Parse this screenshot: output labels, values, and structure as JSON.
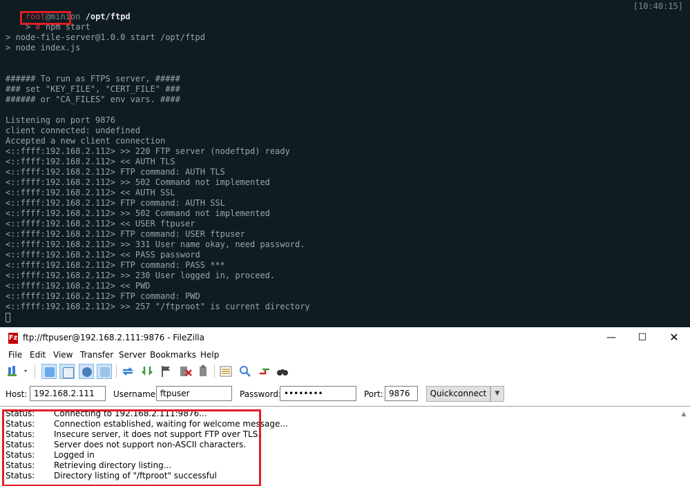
{
  "terminal": {
    "header": {
      "user": "root",
      "host": "@minion",
      "path": "/opt/ftpd",
      "time": "[10:40:15]"
    },
    "prompt": {
      "gt": ">",
      "hash": "#",
      "command": "npm start"
    },
    "lines": [
      "> node-file-server@1.0.0 start /opt/ftpd",
      "> node index.js",
      "",
      "",
      "###### To run as FTPS server, #####",
      "### set \"KEY_FILE\", \"CERT_FILE\" ###",
      "###### or \"CA_FILES\" env vars. ####",
      "",
      "Listening on port 9876",
      "client connected: undefined",
      "Accepted a new client connection",
      "<::ffff:192.168.2.112> >> 220 FTP server (nodeftpd) ready",
      "<::ffff:192.168.2.112> << AUTH TLS",
      "<::ffff:192.168.2.112> FTP command: AUTH TLS",
      "<::ffff:192.168.2.112> >> 502 Command not implemented",
      "<::ffff:192.168.2.112> << AUTH SSL",
      "<::ffff:192.168.2.112> FTP command: AUTH SSL",
      "<::ffff:192.168.2.112> >> 502 Command not implemented",
      "<::ffff:192.168.2.112> << USER ftpuser",
      "<::ffff:192.168.2.112> FTP command: USER ftpuser",
      "<::ffff:192.168.2.112> >> 331 User name okay, need password.",
      "<::ffff:192.168.2.112> << PASS password",
      "<::ffff:192.168.2.112> FTP command: PASS ***",
      "<::ffff:192.168.2.112> >> 230 User logged in, proceed.",
      "<::ffff:192.168.2.112> << PWD",
      "<::ffff:192.168.2.112> FTP command: PWD",
      "<::ffff:192.168.2.112> >> 257 \"/ftproot\" is current directory"
    ]
  },
  "filezilla": {
    "title": "ftp://ftpuser@192.168.2.111:9876 - FileZilla",
    "app_icon_letter": "Fz",
    "window_controls": {
      "minimize": "—",
      "maximize": "☐",
      "close": "✕"
    },
    "menu": [
      "File",
      "Edit",
      "View",
      "Transfer",
      "Server",
      "Bookmarks",
      "Help"
    ],
    "toolbar_icons": [
      "site-manager-icon",
      "toggle-message-log-icon",
      "toggle-local-tree-icon",
      "toggle-remote-tree-icon",
      "toggle-transfer-queue-icon",
      "refresh-icon",
      "process-queue-icon",
      "cancel-operation-icon",
      "disconnect-icon",
      "reconnect-icon",
      "directory-listing-filters-icon",
      "toggle-comparison-icon",
      "synchronized-browsing-icon",
      "search-remote-icon"
    ],
    "quickconnect": {
      "host_label": "Host:",
      "host_value": "192.168.2.111",
      "username_label": "Username:",
      "username_value": "ftpuser",
      "password_label": "Password:",
      "password_value": "••••••••",
      "port_label": "Port:",
      "port_value": "9876",
      "button_label": "Quickconnect",
      "dropdown_arrow": "▼"
    },
    "log": [
      {
        "type": "Status:",
        "message": "Connecting to 192.168.2.111:9876..."
      },
      {
        "type": "Status:",
        "message": "Connection established, waiting for welcome message..."
      },
      {
        "type": "Status:",
        "message": "Insecure server, it does not support FTP over TLS."
      },
      {
        "type": "Status:",
        "message": "Server does not support non-ASCII characters."
      },
      {
        "type": "Status:",
        "message": "Logged in"
      },
      {
        "type": "Status:",
        "message": "Retrieving directory listing..."
      },
      {
        "type": "Status:",
        "message": "Directory listing of \"/ftproot\" successful"
      }
    ],
    "colors": {
      "highlight": "#e01e26",
      "terminal_bg": "#0f1c21",
      "active_toolbar": "#cce4f7"
    }
  }
}
